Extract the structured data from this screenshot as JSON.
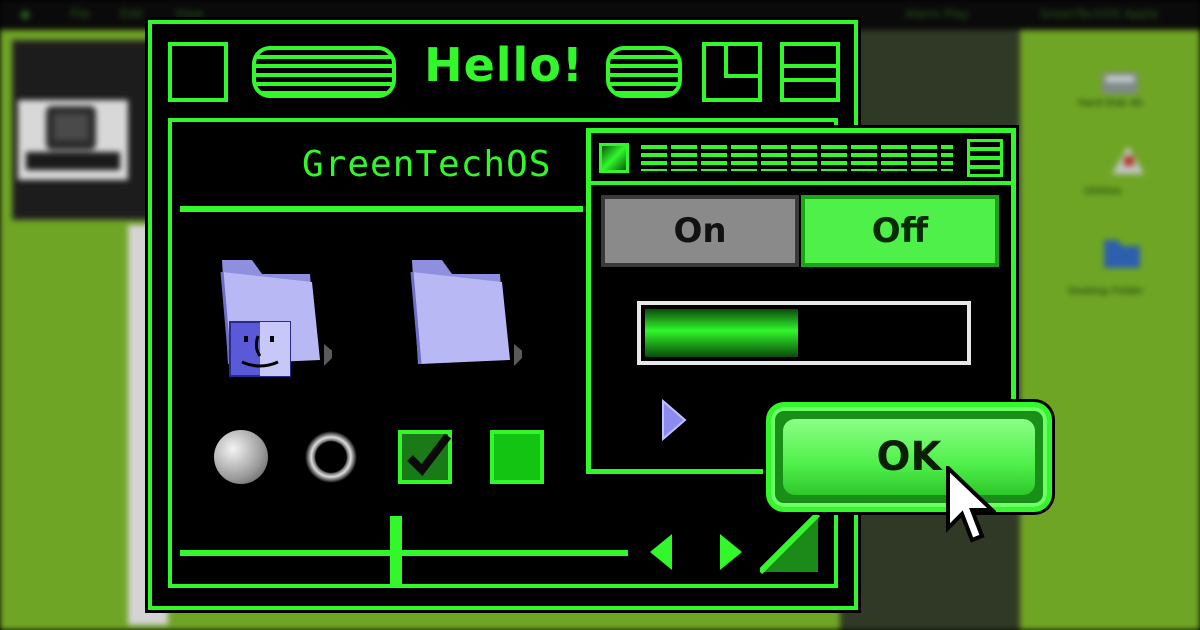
{
  "background": {
    "menu_items": [
      "File",
      "Edit",
      "View"
    ],
    "right_menu": [
      "Alarm Play",
      "GreenTechOS Apple"
    ],
    "icons": [
      {
        "name": "hard-disk-icon",
        "label": "Hard Disk 40"
      },
      {
        "name": "utilities-icon",
        "label": "Utilities"
      },
      {
        "name": "desktop-folder-icon",
        "label": "Desktop Folder"
      }
    ]
  },
  "window": {
    "title": "Hello!",
    "brand": "GreenTechOS"
  },
  "dialog": {
    "toggle_on_label": "On",
    "toggle_off_label": "Off",
    "progress": 0.48
  },
  "ok_button": {
    "label": "OK"
  },
  "colors": {
    "accent": "#31f72b",
    "background": "#000000",
    "desktop": "#6fa524"
  }
}
